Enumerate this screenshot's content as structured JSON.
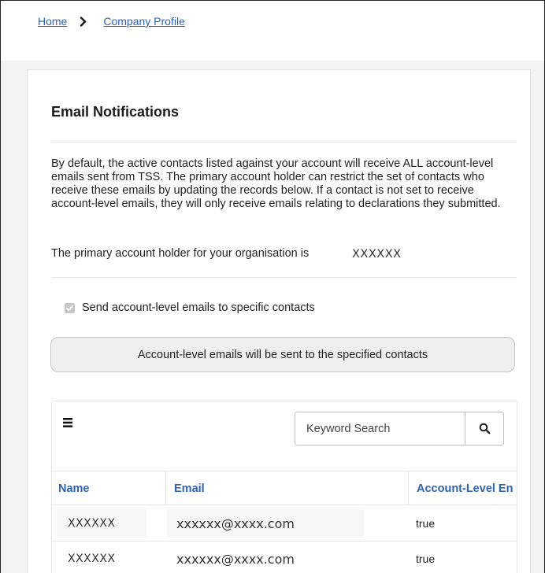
{
  "breadcrumb": {
    "home": "Home",
    "current": "Company Profile"
  },
  "section": {
    "title": "Email Notifications",
    "description": "By default, the active contacts listed against your account will receive ALL account-level emails sent from TSS. The primary account holder can restrict the set of contacts who receive these emails by updating the records below. If a contact is not set to receive account-level emails, they will only receive emails relating to declarations they submitted.",
    "primary_label": "The primary account holder for your organisation is",
    "primary_value": "XXXXXX"
  },
  "checkbox": {
    "label": "Send account-level emails to specific contacts",
    "checked": true,
    "disabled": true
  },
  "notice": {
    "text": "Account-level emails will be sent to the specified contacts"
  },
  "table": {
    "menu_icon": "hamburger-menu-icon",
    "search": {
      "placeholder": "Keyword Search",
      "icon": "search-icon"
    },
    "columns": [
      "Name",
      "Email",
      "Account-Level En"
    ],
    "rows": [
      {
        "name": "XXXXXX",
        "email": "xxxxxx@xxxx.com",
        "account_level": "true"
      },
      {
        "name": "XXXXXX",
        "email": "xxxxxx@xxxx.com",
        "account_level": "true"
      }
    ]
  },
  "colors": {
    "link": "#2e62b7",
    "notice_bg": "#efefef",
    "page_bg": "#f3f3f3"
  }
}
